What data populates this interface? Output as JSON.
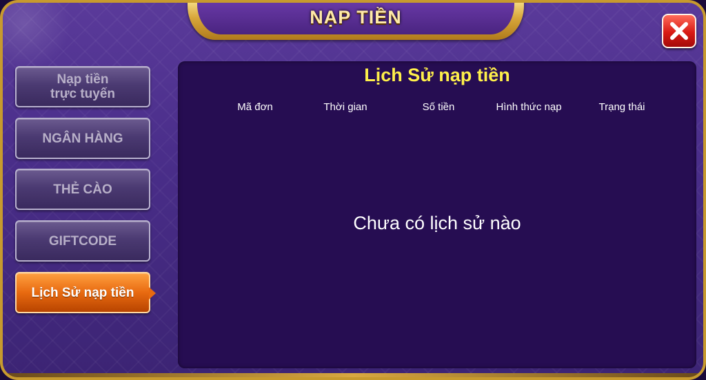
{
  "header": {
    "title": "NẠP TIỀN",
    "close_icon": "close-icon"
  },
  "sidebar": {
    "items": [
      {
        "label": "Nạp tiền\ntrực tuyến",
        "active": false
      },
      {
        "label": "NGÂN HÀNG",
        "active": false
      },
      {
        "label": "THẺ CÀO",
        "active": false
      },
      {
        "label": "GIFTCODE",
        "active": false
      },
      {
        "label": "Lịch Sử nạp tiền",
        "active": true
      }
    ]
  },
  "main": {
    "title": "Lịch Sử nạp tiền",
    "columns": [
      "Mã đơn",
      "Thời gian",
      "Số tiền",
      "Hình thức nạp",
      "Trạng thái"
    ],
    "empty_message": "Chưa có lịch sử nào"
  },
  "colors": {
    "frame_gold": "#c79a2e",
    "panel_bg": "#260d52",
    "title_yellow": "#fff04a",
    "active_orange": "#e86a10",
    "close_red": "#d81a14"
  }
}
